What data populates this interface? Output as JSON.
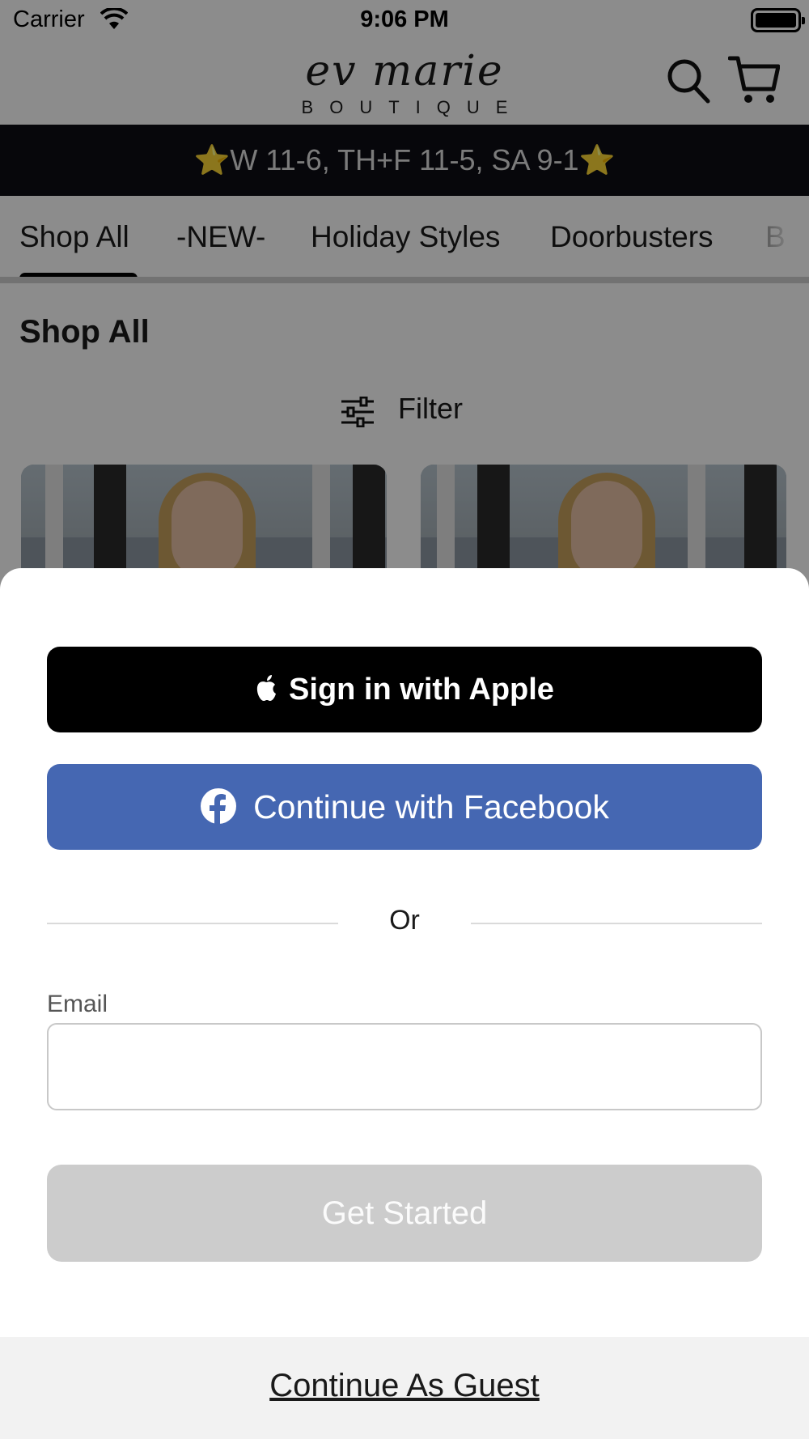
{
  "status_bar": {
    "carrier": "Carrier",
    "time": "9:06 PM"
  },
  "header": {
    "logo_script": "ev marie",
    "logo_sub": "BOUTIQUE",
    "icons": [
      "search-icon",
      "cart-icon"
    ]
  },
  "announcement": {
    "text": "W 11-6, TH+F 11-5, SA 9-1",
    "star": "⭐"
  },
  "nav": {
    "tabs": [
      {
        "label": "Shop All",
        "active": true
      },
      {
        "label": "-NEW-"
      },
      {
        "label": "Holiday Styles"
      },
      {
        "label": "Doorbusters"
      },
      {
        "label": "B"
      }
    ]
  },
  "main": {
    "title": "Shop All",
    "filter_label": "Filter"
  },
  "sheet": {
    "apple_label": "Sign in with Apple",
    "facebook_label": "Continue with Facebook",
    "divider_label": "Or",
    "email_label": "Email",
    "email_value": "",
    "get_started_label": "Get Started",
    "guest_label": "Continue As Guest"
  },
  "colors": {
    "facebook_blue": "#4567b2",
    "apple_black": "#000000",
    "announcement_bg": "#0d0d14",
    "disabled_button": "#cccccc"
  }
}
